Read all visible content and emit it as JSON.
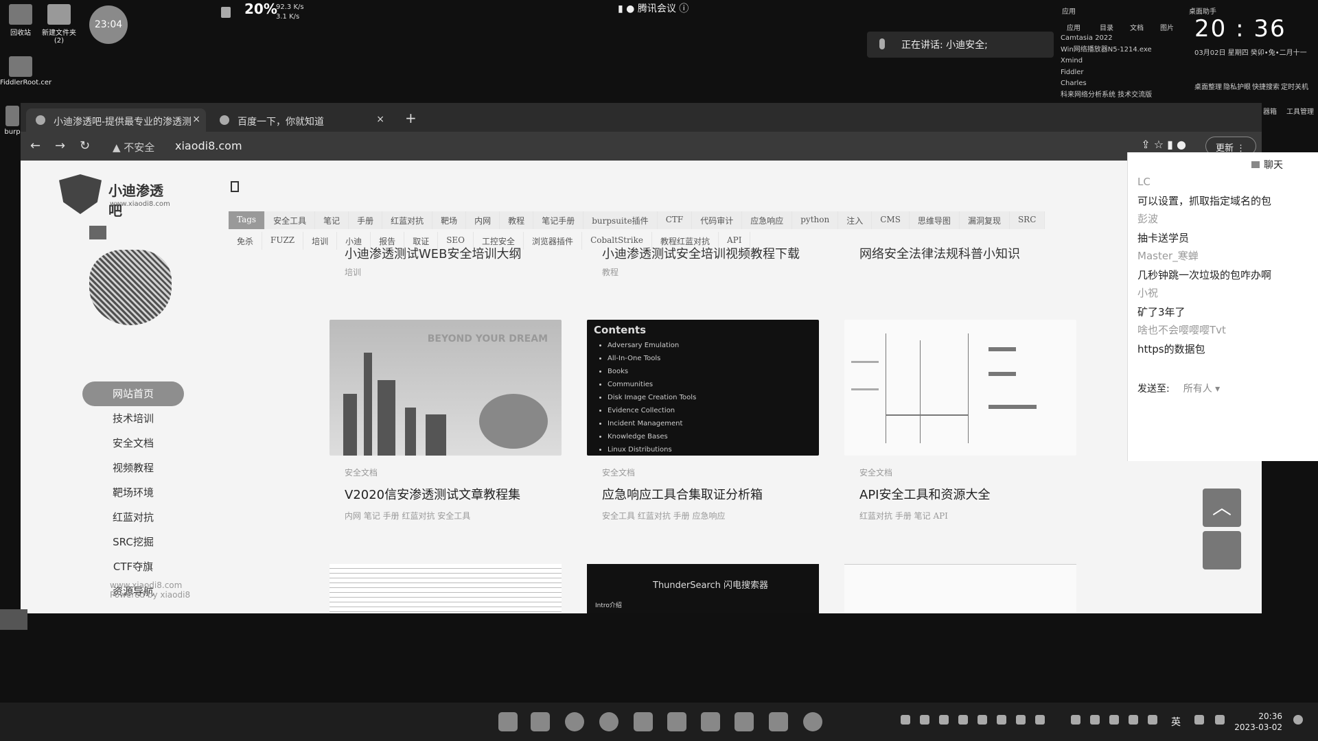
{
  "desktop": {
    "icons": [
      {
        "label": "回收站"
      },
      {
        "label": "新建文件夹 (2)"
      },
      {
        "label": "FiddlerRoot.cer"
      },
      {
        "label": "burp"
      }
    ],
    "circle_clock": "23:04",
    "cpu_percent": "20%",
    "net_up": "92.3 K/s",
    "net_down": "3.1 K/s",
    "meeting_label": "腾讯会议",
    "speaking_label": "正在讲话: 小迪安全;",
    "app_list": [
      "Camtasia 2022",
      "Win网络播放器N5-1214.exe",
      "Xmind",
      "Fiddler",
      "Charles",
      "科来网络分析系统 技术交流版"
    ],
    "tray_header": [
      "应用",
      "桌面助手"
    ],
    "tray_sub": [
      "应用",
      "目录",
      "文档",
      "图片"
    ],
    "big_clock": "20 : 36",
    "date_line": "03月02日  星期四  癸卯•兔•二月十一",
    "quick_actions": [
      "桌面整理",
      "隐私护眼",
      "快捷搜索",
      "定时关机"
    ],
    "quick_actions2": [
      "器箱",
      "工具管理"
    ]
  },
  "browser": {
    "tabs": [
      {
        "title": "小迪渗透吧-提供最专业的渗透测",
        "close": "×",
        "active": true
      },
      {
        "title": "百度一下，你就知道",
        "close": "×",
        "active": false
      }
    ],
    "new_tab": "+",
    "nav": {
      "back": "←",
      "forward": "→",
      "reload": "↻"
    },
    "security_label": "▲ 不安全",
    "url": "xiaodi8.com",
    "update_label": "更新 ⋮",
    "addr_icons": "⇪  ☆  ▮  ●"
  },
  "page": {
    "logo_text": "小迪渗透吧",
    "logo_sub": "www.xiaodi8.com",
    "side_nav": [
      "网站首页",
      "技术培训",
      "安全文档",
      "视频教程",
      "靶场环境",
      "红蓝对抗",
      "SRC挖掘",
      "CTF夺旗",
      "资源导航"
    ],
    "footer": [
      "www.xiaodi8.com",
      "Powered by xiaodi8"
    ],
    "tags_row1": [
      "Tags",
      "安全工具",
      "笔记",
      "手册",
      "红蓝对抗",
      "靶场",
      "内网",
      "教程",
      "笔记手册",
      "burpsuite插件",
      "CTF",
      "代码审计",
      "应急响应",
      "python",
      "注入",
      "CMS",
      "思维导图",
      "漏洞复现",
      "SRC"
    ],
    "tags_row2": [
      "免杀",
      "FUZZ",
      "培训",
      "小迪",
      "报告",
      "取证",
      "SEO",
      "工控安全",
      "浏览器插件",
      "CobaltStrike",
      "教程红蓝对抗",
      "API"
    ],
    "top_items": [
      {
        "title": "小迪渗透测试WEB安全培训大纲",
        "cat": "培训"
      },
      {
        "title": "小迪渗透测试安全培训视频教程下载",
        "cat": "教程"
      },
      {
        "title": "网络安全法律法规科普小知识",
        "cat": ""
      }
    ],
    "cards": [
      {
        "cat": "安全文档",
        "title": "V2020信安渗透测试文章教程集",
        "tags": "内网  笔记  手册  红蓝对抗  安全工具",
        "thumb_text": "BEYOND YOUR DREAM"
      },
      {
        "cat": "安全文档",
        "title": "应急响应工具合集取证分析箱",
        "tags": "安全工具  红蓝对抗  手册  应急响应",
        "thumb_title": "Contents",
        "thumb_items": [
          "Adversary Emulation",
          "All-In-One Tools",
          "Books",
          "Communities",
          "Disk Image Creation Tools",
          "Evidence Collection",
          "Incident Management",
          "Knowledge Bases",
          "Linux Distributions"
        ]
      },
      {
        "cat": "安全文档",
        "title": "API安全工具和资源大全",
        "tags": "红蓝对抗  手册  笔记  API"
      }
    ],
    "bottom_thumb_title": "ThunderSearch 闪电搜索器",
    "bottom_thumb_sub": "Intro介绍",
    "scrolltop": "︿"
  },
  "chat": {
    "header": "聊天",
    "messages": [
      {
        "name": "LC",
        "text": "可以设置，抓取指定域名的包"
      },
      {
        "name": "彭波",
        "text": "抽卡送学员"
      },
      {
        "name": "Master_寒蝉",
        "text": "几秒钟跳一次垃圾的包咋办啊"
      },
      {
        "name": "小祝",
        "text": "矿了3年了"
      },
      {
        "name": "啥也不会嘤嘤嘤Tvt",
        "text": "https的数据包"
      }
    ],
    "send_to_label": "发送至:",
    "send_to_value": "所有人 ▾"
  },
  "taskbar": {
    "lang": "英",
    "time": "20:36",
    "date": "2023-03-02"
  }
}
